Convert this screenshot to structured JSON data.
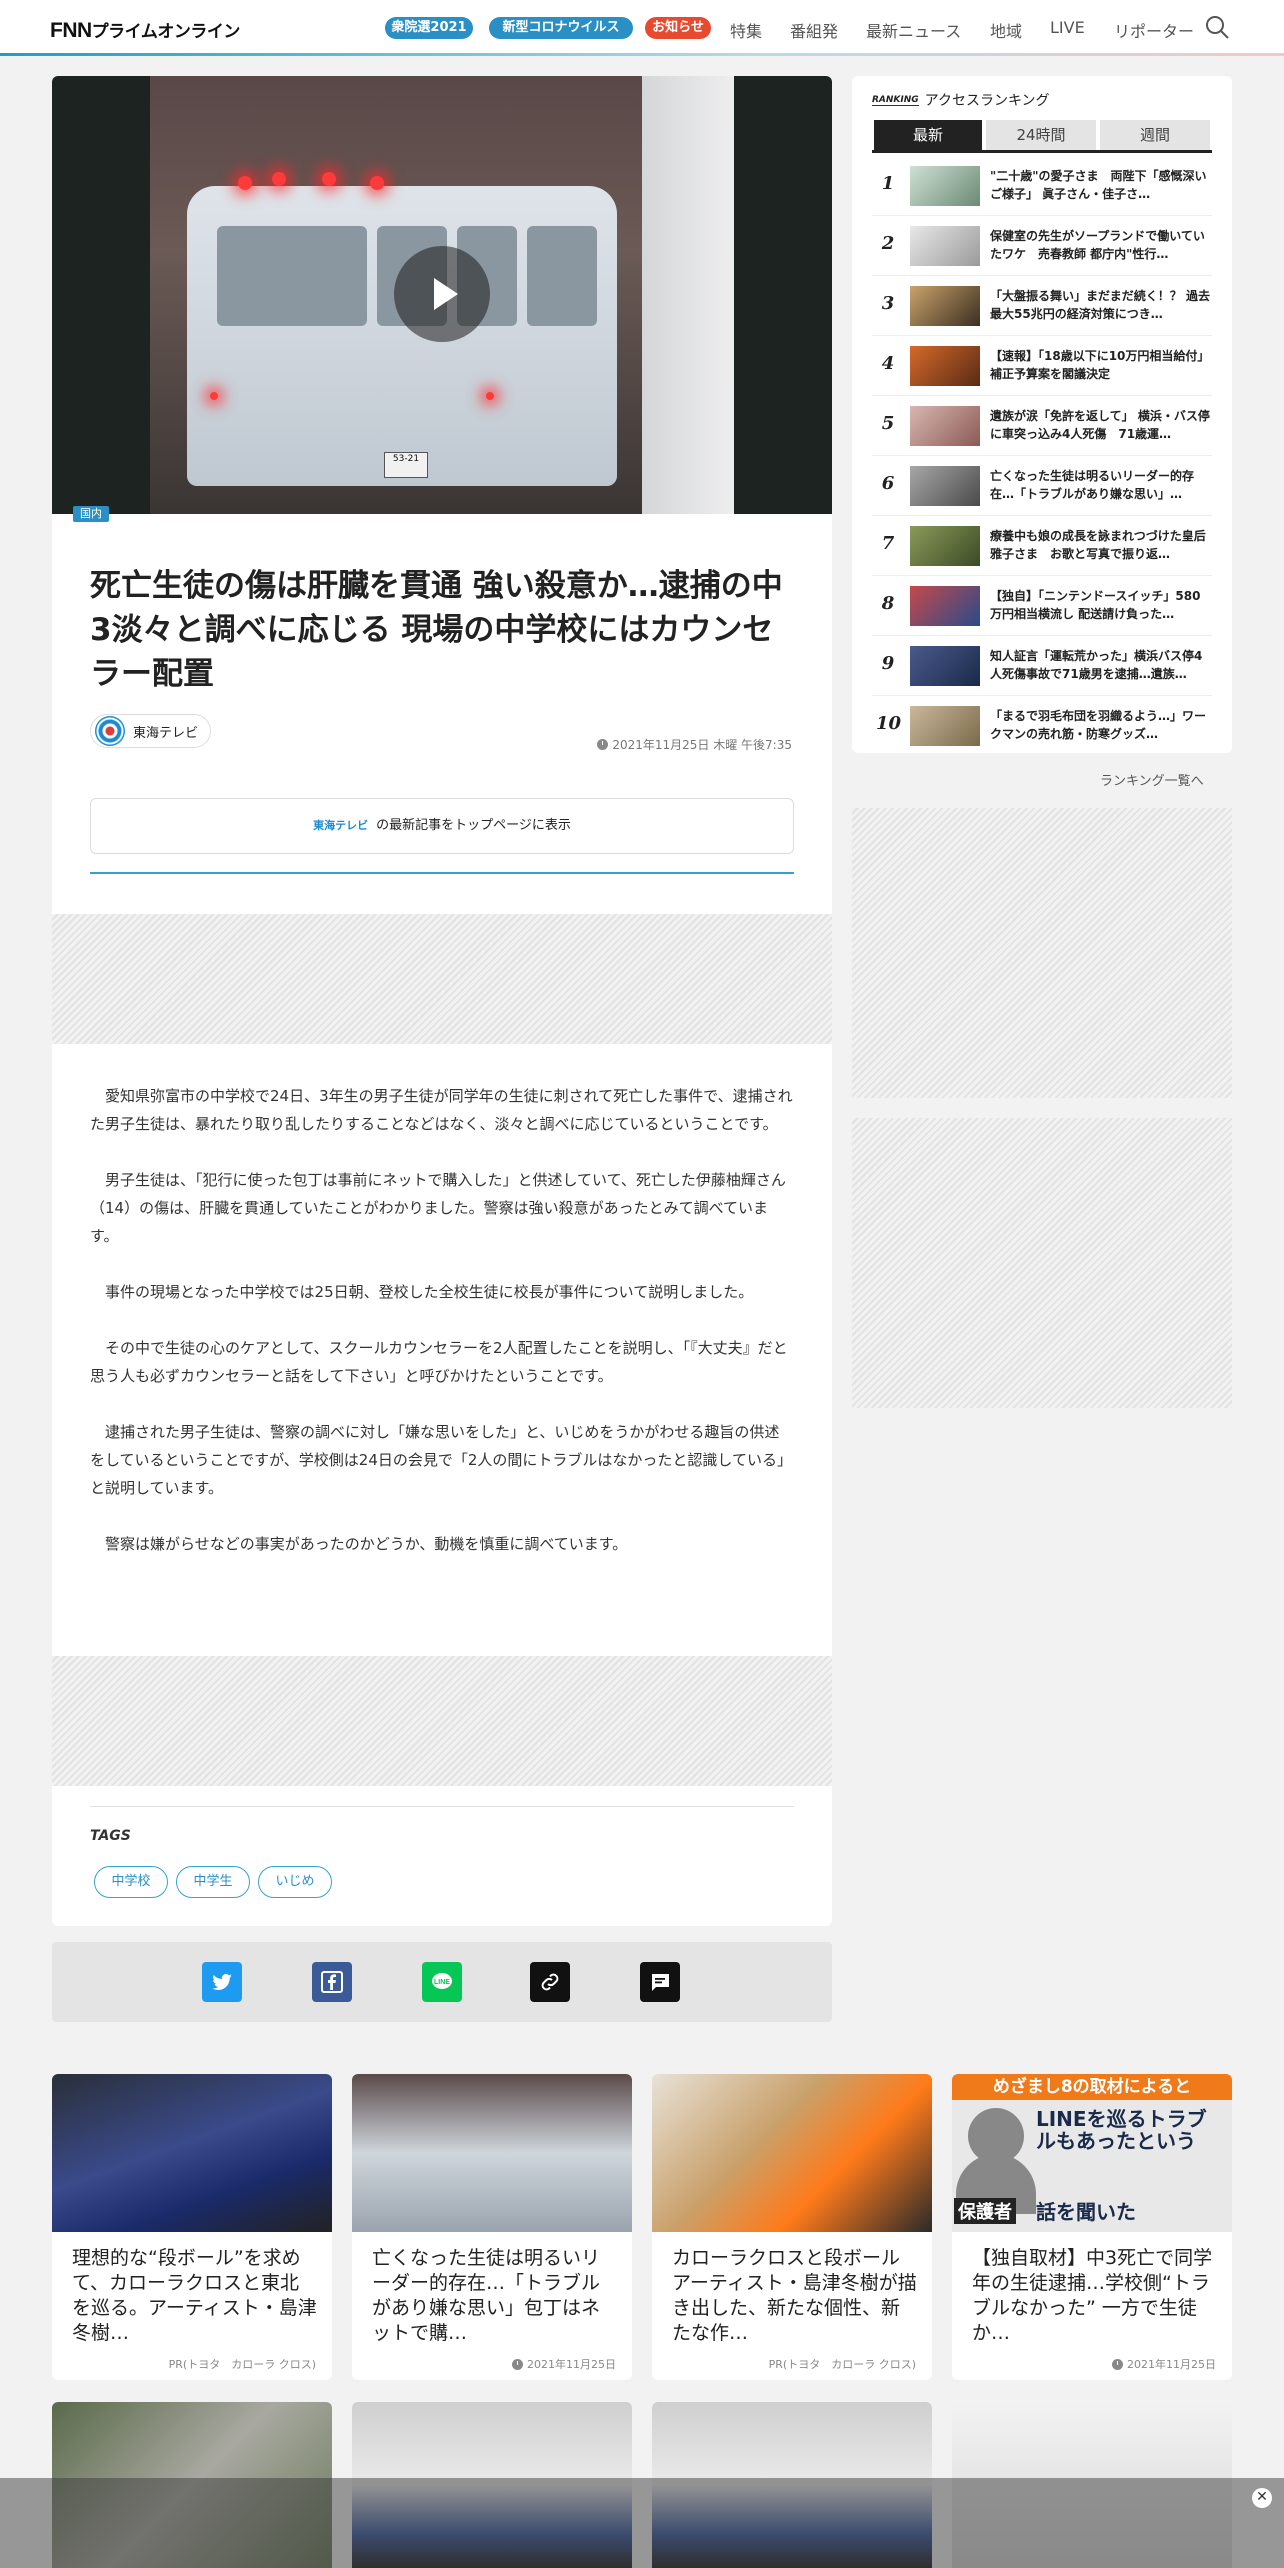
{
  "header": {
    "logo_main": "FNN",
    "logo_sub": "プライムオンライン",
    "pills": [
      "衆院選2021",
      "新型コロナウイルス",
      "お知らせ"
    ],
    "nav": [
      "特集",
      "番組発",
      "最新ニュース",
      "地域",
      "LIVE",
      "リポーター"
    ],
    "search_icon": "search-icon"
  },
  "colors": {
    "accent": "#2a8fc4",
    "alert": "#e94a2f"
  },
  "article": {
    "category": "国内",
    "headline": "死亡生徒の傷は肝臓を貫通 強い殺意か…逮捕の中3淡々と調べに応じる 現場の中学校にはカウンセラー配置",
    "source": "東海テレビ",
    "date": "2021年11月25日 木曜 午後7:35",
    "top_button_logo": "東海テレビ",
    "top_button_label": "の最新記事をトップページに表示",
    "paragraphs": [
      "愛知県弥富市の中学校で24日、3年生の男子生徒が同学年の生徒に刺されて死亡した事件で、逮捕された男子生徒は、暴れたり取り乱したりすることなどはなく、淡々と調べに応じているということです。",
      "男子生徒は、「犯行に使った包丁は事前にネットで購入した」と供述していて、死亡した伊藤柚輝さん（14）の傷は、肝臓を貫通していたことがわかりました。警察は強い殺意があったとみて調べています。",
      "事件の現場となった中学校では25日朝、登校した全校生徒に校長が事件について説明しました。",
      "その中で生徒の心のケアとして、スクールカウンセラーを2人配置したことを説明し、「『大丈夫』だと思う人も必ずカウンセラーと話をして下さい」と呼びかけたということです。",
      "逮捕された男子生徒は、警察の調べに対し「嫌な思いをした」と、いじめをうかがわせる趣旨の供述をしているということですが、学校側は24日の会見で「2人の間にトラブルはなかったと認識している」と説明しています。",
      "警察は嫌がらせなどの事実があったのかどうか、動機を慎重に調べています。"
    ],
    "plate_text": "53-21",
    "tags_title": "TAGS",
    "tags": [
      "中学校",
      "中学生",
      "いじめ"
    ]
  },
  "share": [
    "twitter-icon",
    "facebook-icon",
    "line-icon",
    "link-icon",
    "comment-icon"
  ],
  "share_line_label": "LINE",
  "ranking": {
    "title_en": "RANKING",
    "title": "アクセスランキング",
    "tabs": [
      "最新",
      "24時間",
      "週間"
    ],
    "items": [
      {
        "rank": "1",
        "text": "\"二十歳\"の愛子さま　両陛下「感慨深いご様子」 眞子さん・佳子さ…"
      },
      {
        "rank": "2",
        "text": "保健室の先生がソープランドで働いていたワケ　売春教師 都庁内\"性行…"
      },
      {
        "rank": "3",
        "text": "「大盤振る舞い」まだまだ続く！？ 過去最大55兆円の経済対策につき…"
      },
      {
        "rank": "4",
        "text": "【速報】「18歳以下に10万円相当給付」補正予算案を閣議決定"
      },
      {
        "rank": "5",
        "text": "遺族が涙「免許を返して」 横浜・バス停に車突っ込み4人死傷　71歳運…"
      },
      {
        "rank": "6",
        "text": "亡くなった生徒は明るいリーダー的存在…「トラブルがあり嫌な思い」…"
      },
      {
        "rank": "7",
        "text": "療養中も娘の成長を詠まれつづけた皇后雅子さま　お歌と写真で振り返…"
      },
      {
        "rank": "8",
        "text": "【独自】「ニンテンドースイッチ」580万円相当横流し 配送請け負った…"
      },
      {
        "rank": "9",
        "text": "知人証言「運転荒かった」横浜バス停4人死傷事故で71歳男を逮捕…遺族…"
      },
      {
        "rank": "10",
        "text": "「まるで羽毛布団を羽織るよう…」ワークマンの売れ筋・防寒グッズ…"
      }
    ],
    "more": "ランキング一覧へ"
  },
  "related": [
    {
      "title": "理想的な“段ボール”を求めて、カローラクロスと東北を巡る。アーティスト・島津冬樹…",
      "meta": "PR(トヨタ　カローラ クロス)"
    },
    {
      "title": "亡くなった生徒は明るいリーダー的存在…「トラブルがあり嫌な思い」包丁はネットで購…",
      "meta": "2021年11月25日"
    },
    {
      "title": "カローラクロスと段ボールアーティスト・島津冬樹が描き出した、新たな個性、新たな作…",
      "meta": "PR(トヨタ　カローラ クロス)"
    },
    {
      "title": "【独自取材】中3死亡で同学年の生徒逮捕…学校側“トラブルなかった” 一方で生徒か…",
      "meta": "2021年11月25日"
    }
  ],
  "related_card4_image": {
    "banner": "めざまし8の取材によると",
    "big_text": "LINEを巡るトラブルもあったという",
    "label": "保護者",
    "sub": "話を聞いた"
  },
  "overlay_close": "✕"
}
